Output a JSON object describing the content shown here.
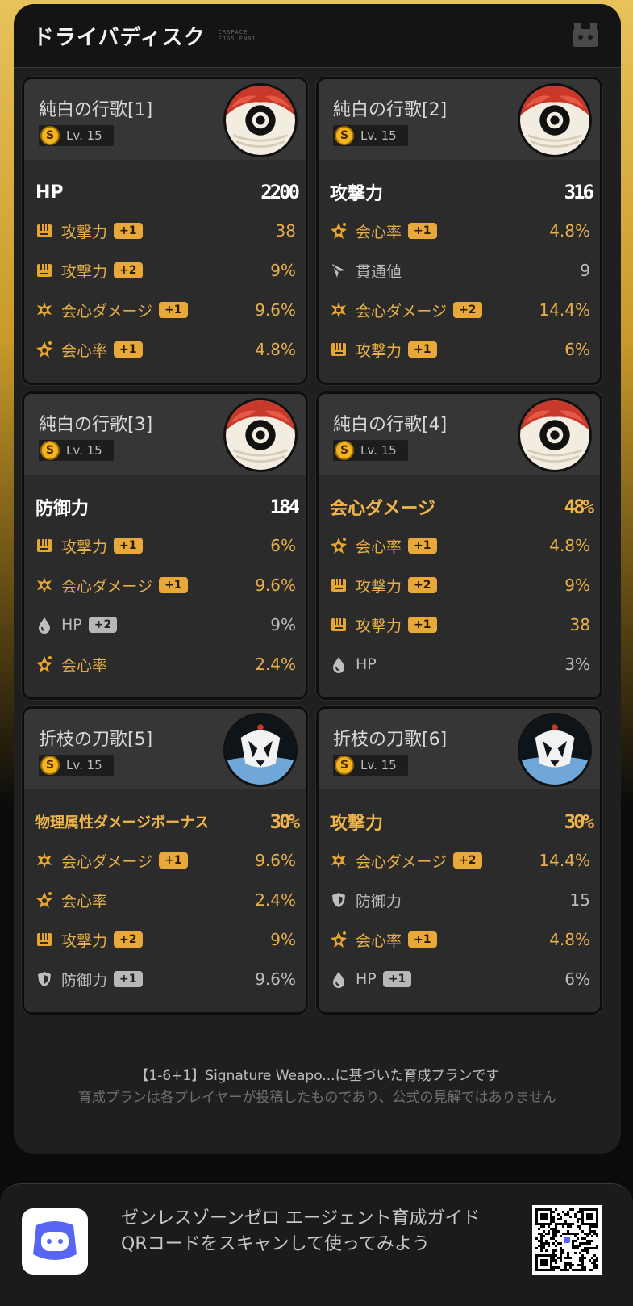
{
  "header": {
    "title": "ドライバディスク",
    "deco_text": [
      "CRSPACE",
      "EJGS EN01"
    ]
  },
  "discs": [
    {
      "name": "純白の行歌[1]",
      "rank": "S",
      "level": "Lv. 15",
      "art": "white-song",
      "main": {
        "label": "HP",
        "value": "2200",
        "style": "white",
        "icon": ""
      },
      "subs": [
        {
          "icon": "attack-icon",
          "label": "攻撃力",
          "badge": "+1",
          "value": "38",
          "style": "gold"
        },
        {
          "icon": "attack-icon",
          "label": "攻撃力",
          "badge": "+2",
          "value": "9%",
          "style": "gold"
        },
        {
          "icon": "crit-damage-icon",
          "label": "会心ダメージ",
          "badge": "+1",
          "value": "9.6%",
          "style": "gold"
        },
        {
          "icon": "crit-rate-icon",
          "label": "会心率",
          "badge": "+1",
          "value": "4.8%",
          "style": "gold"
        }
      ]
    },
    {
      "name": "純白の行歌[2]",
      "rank": "S",
      "level": "Lv. 15",
      "art": "white-song",
      "main": {
        "label": "攻撃力",
        "value": "316",
        "style": "white"
      },
      "subs": [
        {
          "icon": "crit-rate-icon",
          "label": "会心率",
          "badge": "+1",
          "value": "4.8%",
          "style": "gold"
        },
        {
          "icon": "pen-icon",
          "label": "貫通値",
          "badge": "",
          "value": "9",
          "style": "gray"
        },
        {
          "icon": "crit-damage-icon",
          "label": "会心ダメージ",
          "badge": "+2",
          "value": "14.4%",
          "style": "gold"
        },
        {
          "icon": "attack-icon",
          "label": "攻撃力",
          "badge": "+1",
          "value": "6%",
          "style": "gold"
        }
      ]
    },
    {
      "name": "純白の行歌[3]",
      "rank": "S",
      "level": "Lv. 15",
      "art": "white-song",
      "main": {
        "label": "防御力",
        "value": "184",
        "style": "white"
      },
      "subs": [
        {
          "icon": "attack-icon",
          "label": "攻撃力",
          "badge": "+1",
          "value": "6%",
          "style": "gold"
        },
        {
          "icon": "crit-damage-icon",
          "label": "会心ダメージ",
          "badge": "+1",
          "value": "9.6%",
          "style": "gold"
        },
        {
          "icon": "hp-icon",
          "label": "HP",
          "badge": "+2",
          "value": "9%",
          "style": "gray"
        },
        {
          "icon": "crit-rate-icon",
          "label": "会心率",
          "badge": "",
          "value": "2.4%",
          "style": "gold"
        }
      ]
    },
    {
      "name": "純白の行歌[4]",
      "rank": "S",
      "level": "Lv. 15",
      "art": "white-song",
      "main": {
        "label": "会心ダメージ",
        "value": "48%",
        "style": "gold"
      },
      "subs": [
        {
          "icon": "crit-rate-icon",
          "label": "会心率",
          "badge": "+1",
          "value": "4.8%",
          "style": "gold"
        },
        {
          "icon": "attack-icon",
          "label": "攻撃力",
          "badge": "+2",
          "value": "9%",
          "style": "gold"
        },
        {
          "icon": "attack-icon",
          "label": "攻撃力",
          "badge": "+1",
          "value": "38",
          "style": "gold"
        },
        {
          "icon": "hp-icon",
          "label": "HP",
          "badge": "",
          "value": "3%",
          "style": "gray"
        }
      ]
    },
    {
      "name": "折枝の刀歌[5]",
      "rank": "S",
      "level": "Lv. 15",
      "art": "branch-song",
      "main": {
        "label": "物理属性ダメージボーナス",
        "value": "30%",
        "style": "gold",
        "small": true
      },
      "subs": [
        {
          "icon": "crit-damage-icon",
          "label": "会心ダメージ",
          "badge": "+1",
          "value": "9.6%",
          "style": "gold"
        },
        {
          "icon": "crit-rate-icon",
          "label": "会心率",
          "badge": "",
          "value": "2.4%",
          "style": "gold"
        },
        {
          "icon": "attack-icon",
          "label": "攻撃力",
          "badge": "+2",
          "value": "9%",
          "style": "gold"
        },
        {
          "icon": "defense-icon",
          "label": "防御力",
          "badge": "+1",
          "value": "9.6%",
          "style": "gray"
        }
      ]
    },
    {
      "name": "折枝の刀歌[6]",
      "rank": "S",
      "level": "Lv. 15",
      "art": "branch-song",
      "main": {
        "label": "攻撃力",
        "value": "30%",
        "style": "gold"
      },
      "subs": [
        {
          "icon": "crit-damage-icon",
          "label": "会心ダメージ",
          "badge": "+2",
          "value": "14.4%",
          "style": "gold"
        },
        {
          "icon": "defense-icon",
          "label": "防御力",
          "badge": "",
          "value": "15",
          "style": "gray"
        },
        {
          "icon": "crit-rate-icon",
          "label": "会心率",
          "badge": "+1",
          "value": "4.8%",
          "style": "gold"
        },
        {
          "icon": "hp-icon",
          "label": "HP",
          "badge": "+1",
          "value": "6%",
          "style": "gray"
        }
      ]
    }
  ],
  "footnote": {
    "line1": "【1-6+1】Signature Weapo...に基づいた育成プランです",
    "line2": "育成プランは各プレイヤーが投稿したものであり、公式の見解ではありません"
  },
  "bottom": {
    "text": "ゼンレスゾーンゼロ エージェント育成ガイド QRコードをスキャンして使ってみよう",
    "app_icon": "discord-bot-icon",
    "qr_icon": "qr-code-icon"
  },
  "colors": {
    "gold": "#e8b04a",
    "panel": "#1f1f1f",
    "card": "#2b2b2b"
  }
}
